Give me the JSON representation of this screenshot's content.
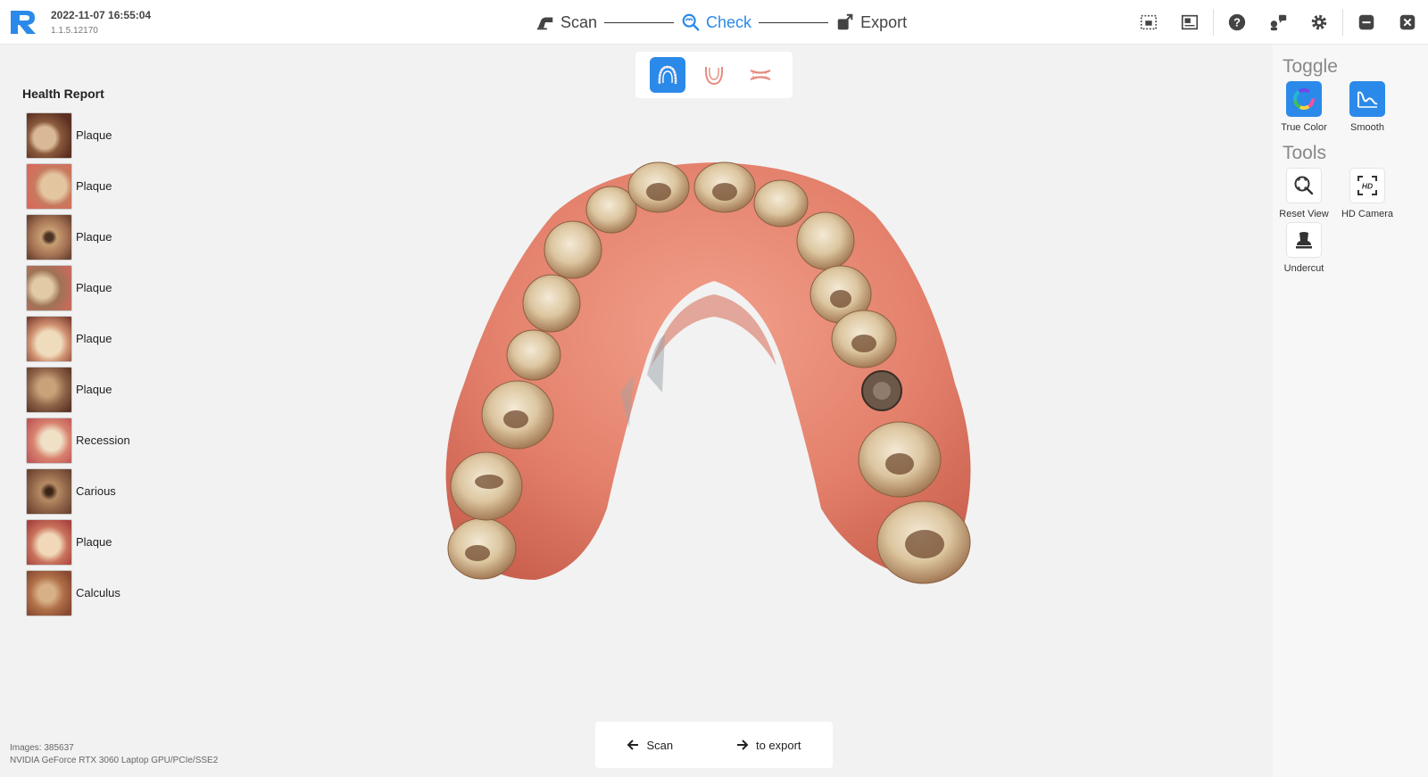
{
  "header": {
    "datetime": "2022-11-07 16:55:04",
    "version": "1.1.5.12170",
    "steps": [
      {
        "label": "Scan",
        "icon": "scanner-icon"
      },
      {
        "label": "Check",
        "icon": "magnifier-check-icon"
      },
      {
        "label": "Export",
        "icon": "export-icon"
      }
    ],
    "active_step": "Check"
  },
  "view_modes": [
    "upper-jaw-icon",
    "lower-jaw-icon",
    "bite-icon"
  ],
  "health_report": {
    "title": "Health Report",
    "items": [
      {
        "label": "Plaque"
      },
      {
        "label": "Plaque"
      },
      {
        "label": "Plaque"
      },
      {
        "label": "Plaque"
      },
      {
        "label": "Plaque"
      },
      {
        "label": "Plaque"
      },
      {
        "label": "Recession"
      },
      {
        "label": "Carious"
      },
      {
        "label": "Plaque"
      },
      {
        "label": "Calculus"
      }
    ]
  },
  "right_panel": {
    "toggle_title": "Toggle",
    "true_color": "True Color",
    "smooth": "Smooth",
    "tools_title": "Tools",
    "reset_view": "Reset View",
    "hd_camera": "HD Camera",
    "undercut": "Undercut"
  },
  "bottom_nav": {
    "back_label": "Scan",
    "next_label": "to export"
  },
  "status": {
    "images": "Images: 385637",
    "gpu": "NVIDIA GeForce RTX 3060 Laptop GPU/PCIe/SSE2"
  },
  "colors": {
    "accent": "#2b8ae9",
    "gum": "#e0836e",
    "tooth": "#e8d8b8"
  }
}
